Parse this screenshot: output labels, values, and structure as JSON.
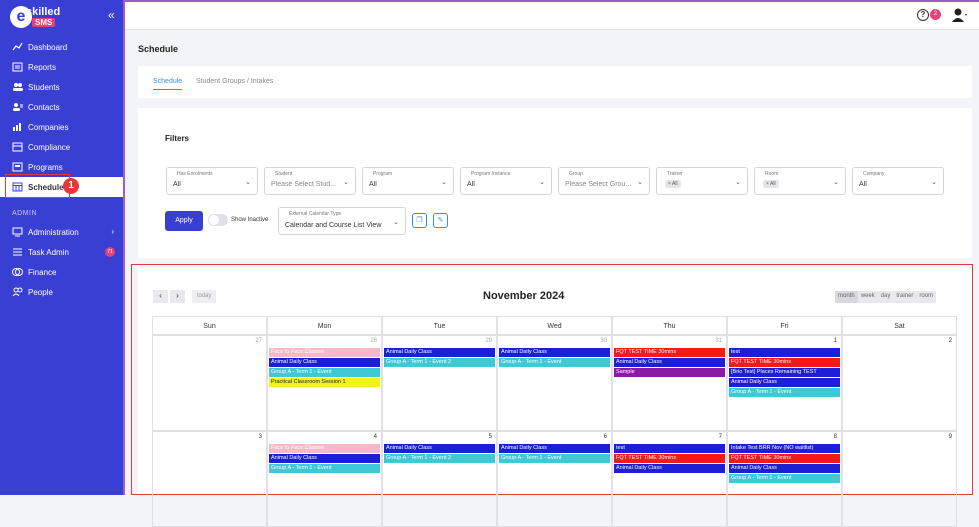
{
  "sidebar": {
    "logo_e": "e",
    "logo_skilled": "skilled",
    "logo_sms": "SMS",
    "collapse": "«",
    "items": [
      {
        "label": "Dashboard",
        "icon": "dashboard-icon"
      },
      {
        "label": "Reports",
        "icon": "reports-icon"
      },
      {
        "label": "Students",
        "icon": "students-icon"
      },
      {
        "label": "Contacts",
        "icon": "contacts-icon"
      },
      {
        "label": "Companies",
        "icon": "companies-icon"
      },
      {
        "label": "Compliance",
        "icon": "compliance-icon"
      },
      {
        "label": "Programs",
        "icon": "programs-icon"
      },
      {
        "label": "Schedule",
        "icon": "schedule-icon",
        "active": true
      }
    ],
    "section": "ADMIN",
    "admin_items": [
      {
        "label": "Administration",
        "icon": "administration-icon"
      },
      {
        "label": "Task Admin",
        "icon": "task-admin-icon",
        "badge": "71"
      },
      {
        "label": "Finance",
        "icon": "finance-icon"
      },
      {
        "label": "People",
        "icon": "people-icon"
      }
    ],
    "callout": "1"
  },
  "topbar": {
    "help": "?",
    "notif": "2"
  },
  "page_title": "Schedule",
  "tabs": [
    "Schedule",
    "Student Groups / Intakes"
  ],
  "filters": {
    "title": "Filters",
    "fields": [
      {
        "label": "Has Enrolments",
        "value": "All"
      },
      {
        "label": "Student",
        "value": "Please Select Stud..."
      },
      {
        "label": "Program",
        "value": "All"
      },
      {
        "label": "Program Instance",
        "value": "All"
      },
      {
        "label": "Group",
        "value": "Please Select Grou..."
      },
      {
        "label": "Trainer",
        "chip": "× All"
      },
      {
        "label": "Room",
        "chip": "× All"
      },
      {
        "label": "Company",
        "value": "All"
      }
    ],
    "apply": "Apply",
    "show_inactive": "Show Inactive",
    "ext_label": "External Calendar Type",
    "ext_value": "Calendar and Course List View"
  },
  "calendar": {
    "prev": "‹",
    "next": "›",
    "today": "today",
    "title": "November 2024",
    "views": [
      "month",
      "week",
      "day",
      "trainer",
      "room"
    ],
    "days": [
      "Sun",
      "Mon",
      "Tue",
      "Wed",
      "Thu",
      "Fri",
      "Sat"
    ],
    "week1": [
      "27",
      "28",
      "29",
      "30",
      "31",
      "1",
      "2"
    ],
    "week2": [
      "3",
      "4",
      "5",
      "6",
      "7",
      "8",
      "9"
    ],
    "colors": {
      "pink": "#f7b9c7",
      "blue": "#1c1fd6",
      "teal": "#3ec9d6",
      "yellow": "#f2f21a",
      "red": "#f51919",
      "purple": "#8a1aa6"
    },
    "events": {
      "mon1": [
        "Face to Face Classes",
        "Animal Daily Class",
        "Group A - Term 1 - Event",
        "Practical Classroom Session 1"
      ],
      "tue1": [
        "Animal Daily Class",
        "Group A - Term 1 - Event 2"
      ],
      "wed1": [
        "Animal Daily Class",
        "Group A - Term 1 - Event"
      ],
      "thu1": [
        "FQT TEST TIME 30mins",
        "Animal Daily Class",
        "Sample"
      ],
      "fri1": [
        "test",
        "FQT TEST TIME 30mins",
        "[Brio Test] Places Remaining TEST",
        "Animal Daily Class",
        "Group A - Term 1 - Event"
      ],
      "mon2": [
        "Face to Face Classes",
        "Animal Daily Class",
        "Group A - Term 1 - Event"
      ],
      "tue2": [
        "Animal Daily Class",
        "Group A - Term 1 - Event 2"
      ],
      "wed2": [
        "Animal Daily Class",
        "Group A - Term 1 - Event"
      ],
      "thu2": [
        "test",
        "FQT TEST TIME 30mins",
        "Animal Daily Class"
      ],
      "fri2": [
        "Intake Test BRR Nov (NO waitlist)",
        "FQT TEST TIME 30mins",
        "Animal Daily Class",
        "Group A - Term 1 - Event"
      ]
    }
  }
}
